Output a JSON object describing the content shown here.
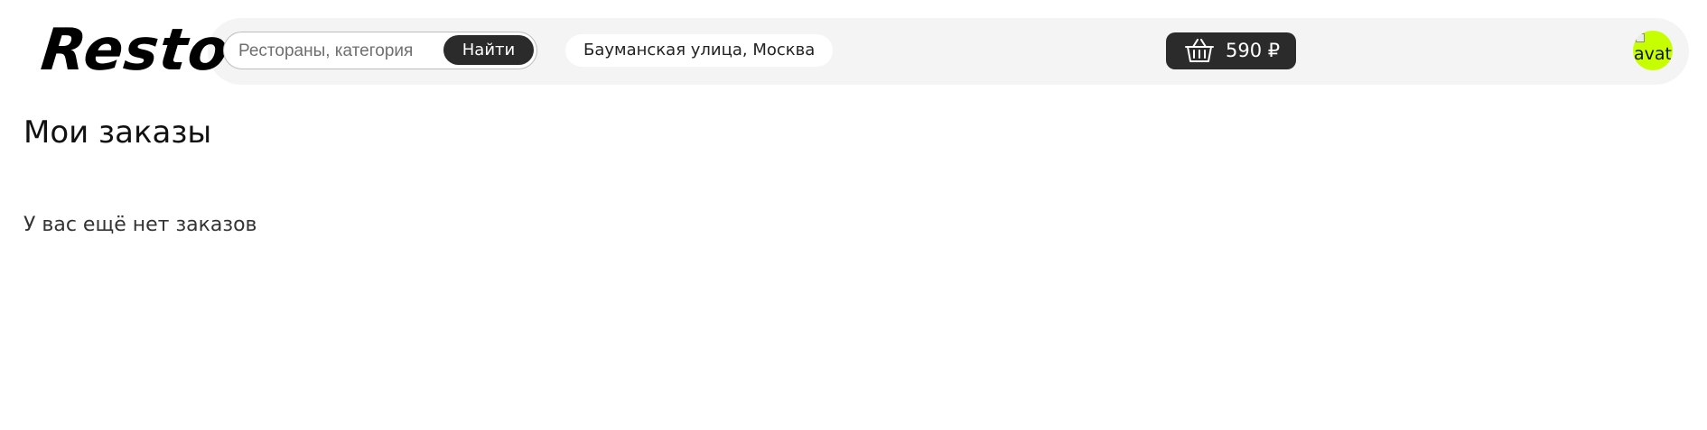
{
  "header": {
    "logo": "Resto",
    "search": {
      "placeholder": "Рестораны, категория",
      "value": "",
      "button_label": "Найти"
    },
    "address": "Бауманская улица, Москва",
    "cart": {
      "icon": "basket-icon",
      "total": "590 ₽"
    },
    "avatar": {
      "alt_text": "avatar",
      "background": "#c6ff00"
    }
  },
  "main": {
    "title": "Мои заказы",
    "empty_message": "У вас ещё нет заказов"
  },
  "colors": {
    "header_bg": "#f4f4f4",
    "dark_button": "#2b2b2b",
    "avatar_accent": "#c6ff00"
  }
}
